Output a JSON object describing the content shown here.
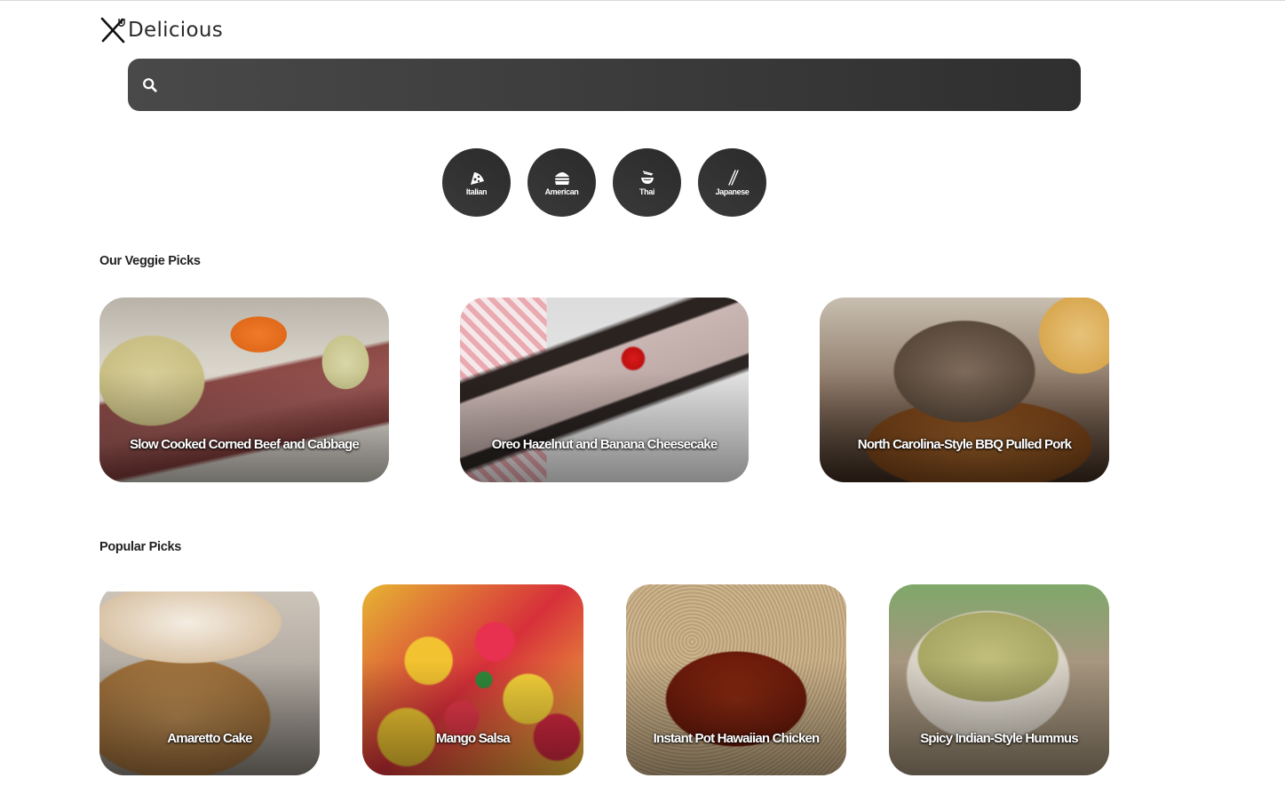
{
  "brand": {
    "name": "Delicious",
    "icon": "fork-knife-icon"
  },
  "search": {
    "icon": "search-icon",
    "value": "",
    "placeholder": ""
  },
  "cuisines": [
    {
      "label": "Italian",
      "icon": "pizza-icon"
    },
    {
      "label": "American",
      "icon": "burger-icon"
    },
    {
      "label": "Thai",
      "icon": "noodle-bowl-icon"
    },
    {
      "label": "Japanese",
      "icon": "chopsticks-icon"
    }
  ],
  "veggie": {
    "title": "Our Veggie Picks",
    "cards": [
      {
        "label": "Slow Cooked Corned Beef and Cabbage"
      },
      {
        "label": "Oreo Hazelnut and Banana Cheesecake"
      },
      {
        "label": "North Carolina-Style BBQ Pulled Pork"
      }
    ]
  },
  "popular": {
    "title": "Popular Picks",
    "cards": [
      {
        "label": "Amaretto Cake"
      },
      {
        "label": "Mango Salsa"
      },
      {
        "label": "Instant Pot Hawaiian Chicken"
      },
      {
        "label": "Spicy Indian-Style Hummus"
      }
    ]
  },
  "colors": {
    "dark": "#333333",
    "text": "#222222",
    "background": "#ffffff"
  }
}
